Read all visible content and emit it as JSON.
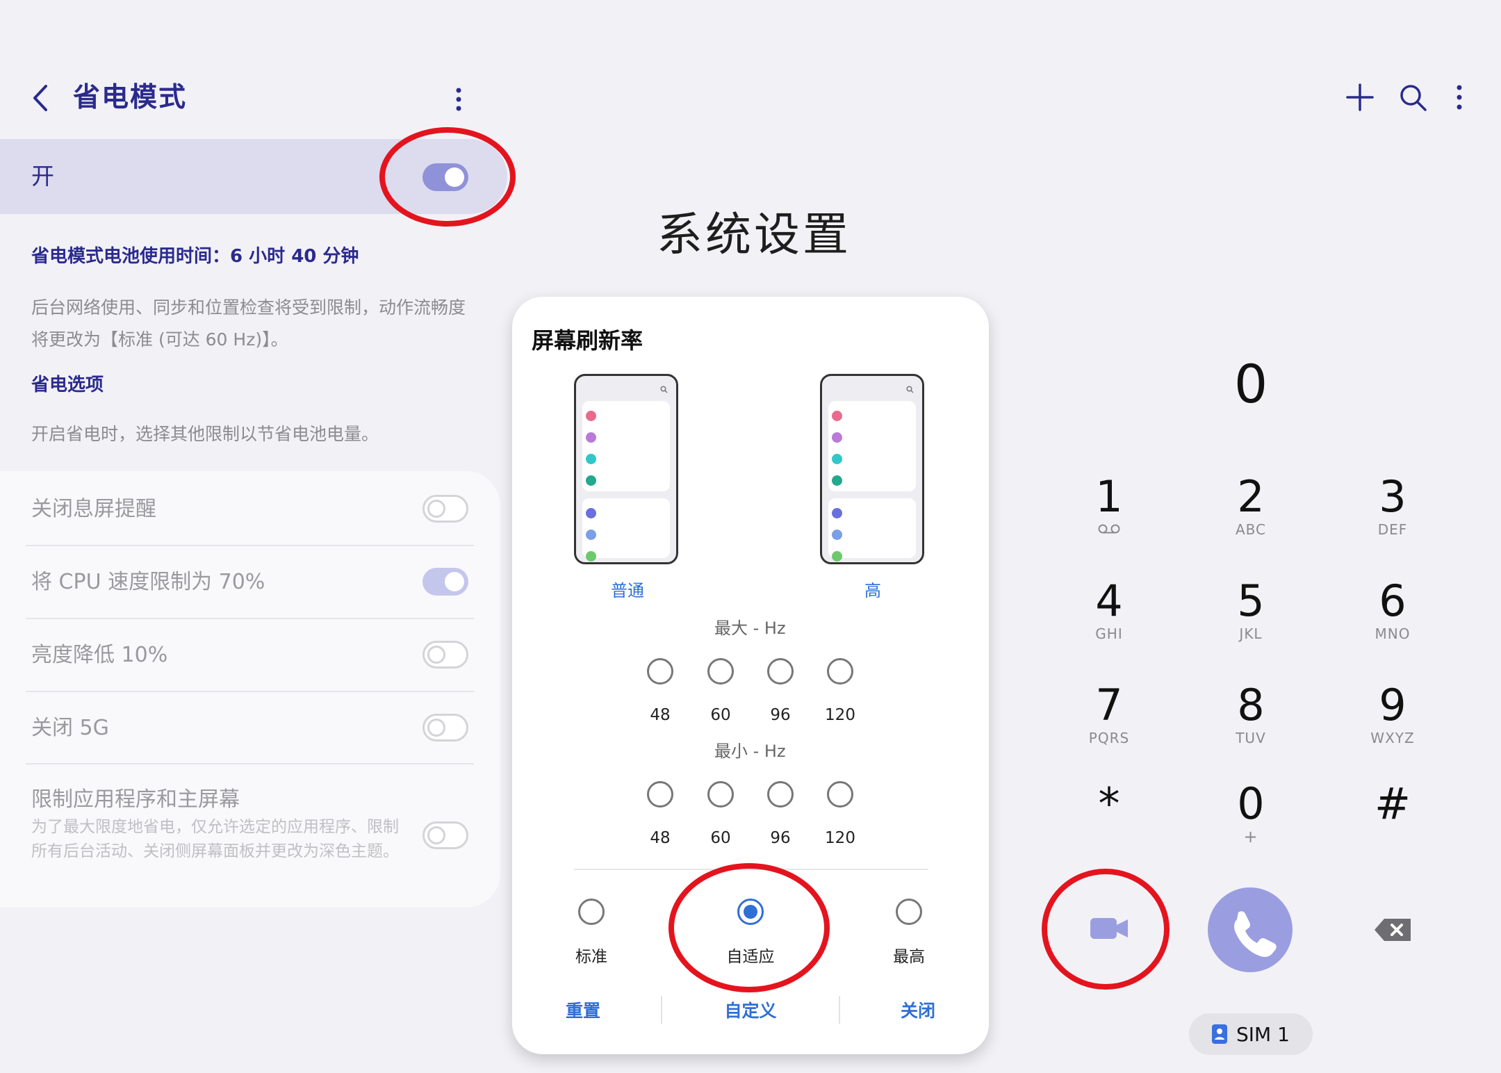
{
  "left_panel": {
    "title": "省电模式",
    "master_label": "开",
    "estimate": "省电模式电池使用时间：6 小时 40 分钟",
    "description": "后台网络使用、同步和位置检查将受到限制，动作流畅度将更改为【标准 (可达 60 Hz)】。",
    "options_heading": "省电选项",
    "options_description": "开启省电时，选择其他限制以节省电池电量。",
    "options": [
      {
        "label": "关闭息屏提醒",
        "on": false
      },
      {
        "label": "将 CPU 速度限制为 70%",
        "on": true
      },
      {
        "label": "亮度降低 10%",
        "on": false
      },
      {
        "label": "关闭 5G",
        "on": false
      },
      {
        "label": "限制应用程序和主屏幕",
        "sub": "为了最大限度地省电，仅允许选定的应用程序、限制所有后台活动、关闭侧屏幕面板并更改为深色主题。",
        "on": false
      }
    ]
  },
  "center": {
    "title": "系统设置",
    "dialog": {
      "title": "屏幕刷新率",
      "modes": [
        "普通",
        "高"
      ],
      "max_header": "最大 - Hz",
      "min_header": "最小 - Hz",
      "max_options": [
        "48",
        "60",
        "96",
        "120"
      ],
      "min_options": [
        "48",
        "60",
        "96",
        "120"
      ],
      "presets": [
        "标准",
        "自适应",
        "最高"
      ],
      "selected_preset": "自适应",
      "actions": [
        "重置",
        "自定义",
        "关闭"
      ]
    }
  },
  "dialer": {
    "display": "0",
    "keys": [
      {
        "digit": "1",
        "letters": ""
      },
      {
        "digit": "2",
        "letters": "ABC"
      },
      {
        "digit": "3",
        "letters": "DEF"
      },
      {
        "digit": "4",
        "letters": "GHI"
      },
      {
        "digit": "5",
        "letters": "JKL"
      },
      {
        "digit": "6",
        "letters": "MNO"
      },
      {
        "digit": "7",
        "letters": "PQRS"
      },
      {
        "digit": "8",
        "letters": "TUV"
      },
      {
        "digit": "9",
        "letters": "WXYZ"
      },
      {
        "digit": "*",
        "letters": ""
      },
      {
        "digit": "0",
        "letters": "+"
      },
      {
        "digit": "#",
        "letters": ""
      }
    ],
    "sim_label": "SIM 1"
  },
  "colors": {
    "accent_navy": "#2b2a8e",
    "accent_blue": "#2f6fd6",
    "toggle_on": "#8f92d8",
    "call_button": "#9a9ee0",
    "annotation_red": "#e4141e"
  },
  "icons": [
    "back-arrow-icon",
    "more-vert-icon",
    "plus-icon",
    "search-icon",
    "voicemail-icon",
    "video-call-icon",
    "phone-icon",
    "backspace-icon",
    "sim-card-icon"
  ]
}
